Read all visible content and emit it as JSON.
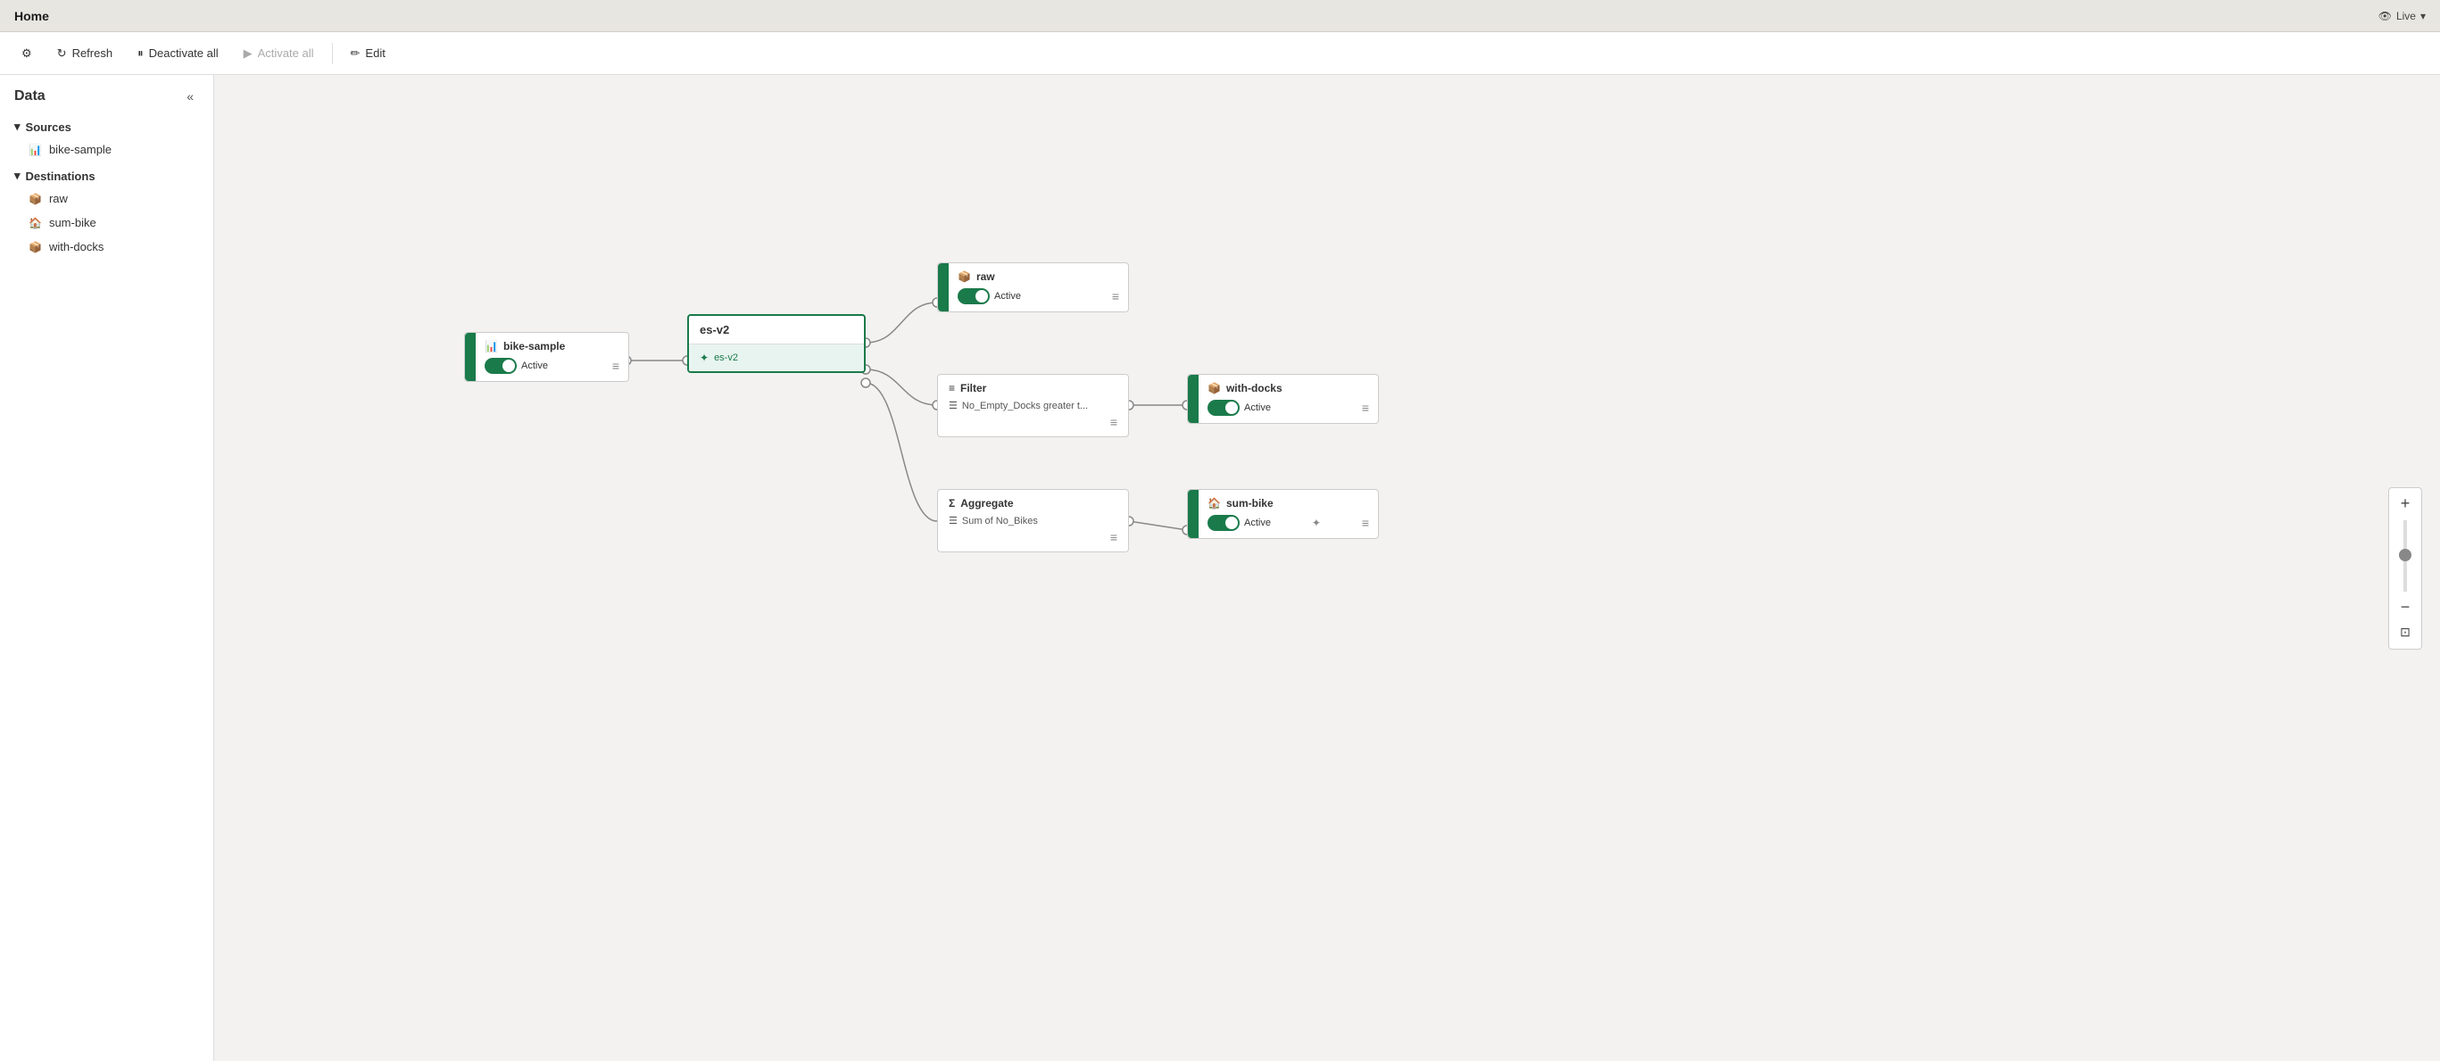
{
  "titleBar": {
    "title": "Home",
    "liveBadge": "Live"
  },
  "toolbar": {
    "settings": "⚙",
    "refresh": "Refresh",
    "deactivateAll": "Deactivate all",
    "activateAll": "Activate all",
    "edit": "Edit"
  },
  "sidebar": {
    "title": "Data",
    "collapseIcon": "«",
    "sections": [
      {
        "name": "Sources",
        "items": [
          "bike-sample"
        ]
      },
      {
        "name": "Destinations",
        "items": [
          "raw",
          "sum-bike",
          "with-docks"
        ]
      }
    ]
  },
  "canvas": {
    "nodes": {
      "bikeSource": {
        "title": "bike-sample",
        "status": "Active"
      },
      "esv2": {
        "title": "es-v2",
        "tag": "es-v2"
      },
      "raw": {
        "title": "raw",
        "status": "Active"
      },
      "filter": {
        "title": "Filter",
        "condition": "No_Empty_Docks greater t..."
      },
      "withDocks": {
        "title": "with-docks",
        "status": "Active"
      },
      "aggregate": {
        "title": "Aggregate",
        "metric": "Sum of No_Bikes"
      },
      "sumBike": {
        "title": "sum-bike",
        "status": "Active"
      }
    }
  },
  "icons": {
    "settings": "⚙",
    "refresh": "↻",
    "deactivate": "⏸",
    "activate": "▶",
    "edit": "✏",
    "eye": "👁",
    "chevronDown": "▾",
    "chevronRight": "▸",
    "source": "📊",
    "database": "🗄",
    "destination": "📥",
    "filter": "≡",
    "aggregate": "Σ",
    "sum": "Σ",
    "tag": "🏷",
    "menu": "≡",
    "collapse": "«",
    "zoomIn": "+",
    "zoomOut": "−",
    "fitScreen": "⊡",
    "raw": "📦",
    "sumBike": "🏠",
    "withDocks": "📦"
  }
}
